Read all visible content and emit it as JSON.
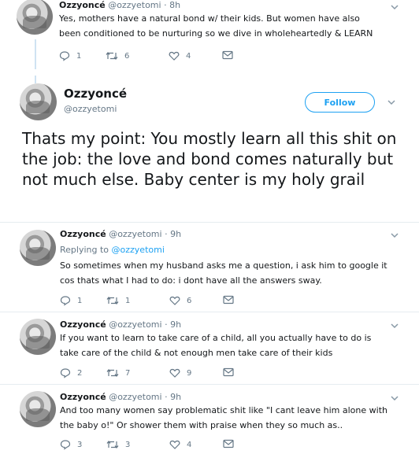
{
  "tweets_above": [
    {
      "name": "Ozzyoncé",
      "handle": "@ozzyetomi",
      "time": "8h",
      "text": "Yes, mothers have a natural bond w/ their kids. But women have also been conditioned to be nurturing so we dive in wholeheartedly & LEARN",
      "replies": "1",
      "retweets": "6",
      "likes": "4"
    }
  ],
  "main_tweet": {
    "name": "Ozzyoncé",
    "handle": "@ozzyetomi",
    "follow_label": "Follow",
    "text": "Thats my point: You mostly learn all this shit on the job: the love and bond comes naturally but not much else. Baby center is my holy grail"
  },
  "replies": [
    {
      "name": "Ozzyoncé",
      "handle": "@ozzyetomi",
      "time": "9h",
      "replying_prefix": "Replying to",
      "replying_to": "@ozzyetomi",
      "text": "So sometimes when my husband asks me a question, i ask him to google it cos thats what I had to do: i dont have all the answers sway.",
      "replies": "1",
      "retweets": "1",
      "likes": "6"
    },
    {
      "name": "Ozzyoncé",
      "handle": "@ozzyetomi",
      "time": "9h",
      "text": "If you want to learn to take care of a child, all you actually have to do is take care of the child & not enough men take care of their kids",
      "replies": "2",
      "retweets": "7",
      "likes": "9"
    },
    {
      "name": "Ozzyoncé",
      "handle": "@ozzyetomi",
      "time": "9h",
      "text": "And too many women say problematic shit like \"I cant leave him alone with the baby o!\" Or shower them with praise when they so much as..",
      "replies": "3",
      "retweets": "3",
      "likes": "4"
    }
  ],
  "separator": "·",
  "icons": {
    "reply": "reply-icon",
    "retweet": "retweet-icon",
    "like": "heart-icon",
    "dm": "envelope-icon",
    "menu": "chevron-down-icon"
  },
  "colors": {
    "accent": "#1da1f2",
    "muted": "#657786",
    "thread_line": "#cfe3f2"
  }
}
